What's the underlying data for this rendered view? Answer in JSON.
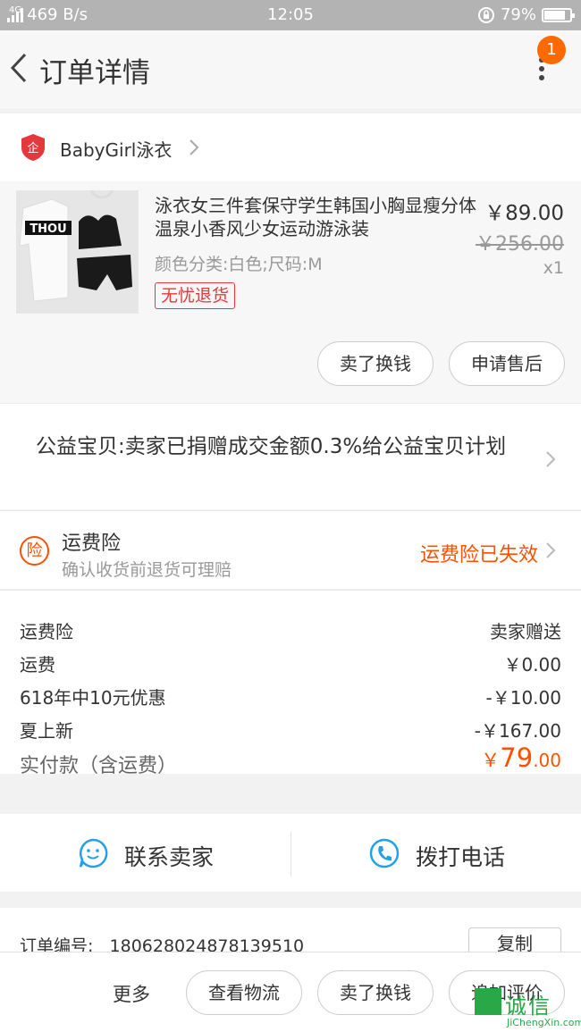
{
  "status_bar": {
    "network": "4G",
    "speed": "469 B/s",
    "time": "12:05",
    "battery": "79%"
  },
  "header": {
    "title": "订单详情",
    "badge": "1"
  },
  "shop": {
    "name": "BabyGirl泳衣",
    "icon": "enterprise-shield-icon"
  },
  "product": {
    "title": "泳衣女三件套保守学生韩国小胸显瘦分体温泉小香风少女运动游泳装",
    "sku": "颜色分类:白色;尺码:M",
    "tag": "无忧退货",
    "price": "￥89.00",
    "original_price": "￥256.00",
    "quantity": "x1",
    "image_text": "THOU"
  },
  "product_actions": {
    "sell": "卖了换钱",
    "after_sale": "申请售后"
  },
  "charity": {
    "text": "公益宝贝:卖家已捐赠成交金额0.3%给公益宝贝计划"
  },
  "insurance": {
    "icon_char": "险",
    "title": "运费险",
    "subtitle": "确认收货前退货可理赔",
    "status": "运费险已失效"
  },
  "fees": [
    {
      "label": "运费险",
      "value": "卖家赠送"
    },
    {
      "label": "运费",
      "value": "￥0.00"
    },
    {
      "label": "618年中10元优惠",
      "value": "-￥10.00"
    },
    {
      "label": "夏上新",
      "value": "-￥167.00"
    }
  ],
  "total": {
    "label": "实付款（含运费）",
    "currency": "￥",
    "integer": "79",
    "decimal": ".00"
  },
  "contact": {
    "seller": "联系卖家",
    "phone": "拨打电话"
  },
  "order": {
    "label": "订单编号:",
    "number": "180628024878139510",
    "copy": "复制"
  },
  "bottom_bar": {
    "more": "更多",
    "logistics": "查看物流",
    "sell": "卖了换钱",
    "review": "追加评价"
  },
  "watermark": {
    "cn": "诚信",
    "en": "JiChengXin.com"
  },
  "colors": {
    "accent": "#ff5000",
    "tag_red": "#e4393c",
    "contact_blue": "#23a0e8"
  }
}
